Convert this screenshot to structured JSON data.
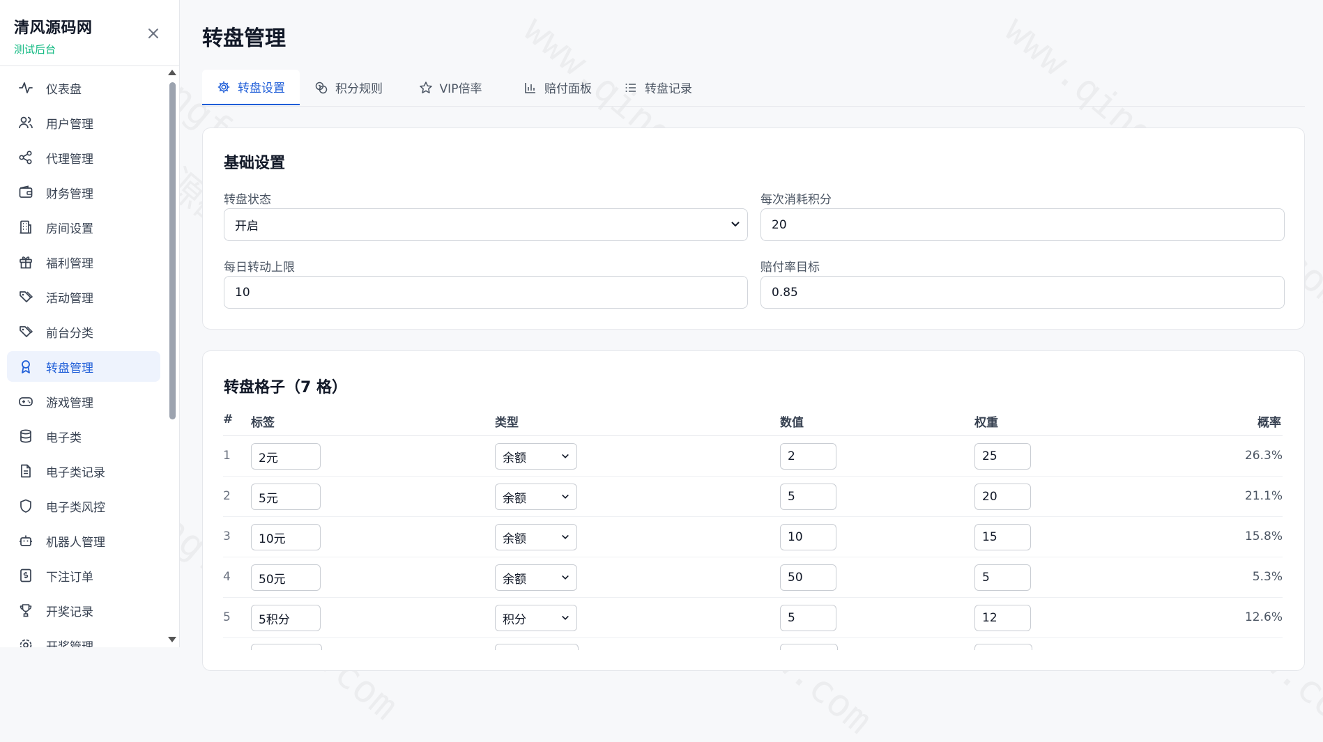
{
  "brand": {
    "title": "清风源码网",
    "subtitle": "测试后台"
  },
  "sidebar": {
    "items": [
      {
        "label": "仪表盘",
        "icon": "activity-icon"
      },
      {
        "label": "用户管理",
        "icon": "users-icon"
      },
      {
        "label": "代理管理",
        "icon": "share-icon"
      },
      {
        "label": "财务管理",
        "icon": "wallet-icon"
      },
      {
        "label": "房间设置",
        "icon": "building-icon"
      },
      {
        "label": "福利管理",
        "icon": "gift-icon"
      },
      {
        "label": "活动管理",
        "icon": "tags-icon"
      },
      {
        "label": "前台分类",
        "icon": "tags-icon"
      },
      {
        "label": "转盘管理",
        "icon": "award-icon",
        "active": true
      },
      {
        "label": "游戏管理",
        "icon": "gamepad-icon"
      },
      {
        "label": "电子类",
        "icon": "database-icon"
      },
      {
        "label": "电子类记录",
        "icon": "file-text-icon"
      },
      {
        "label": "电子类风控",
        "icon": "shield-icon"
      },
      {
        "label": "机器人管理",
        "icon": "bot-icon"
      },
      {
        "label": "下注订单",
        "icon": "receipt-icon"
      },
      {
        "label": "开奖记录",
        "icon": "trophy-icon"
      },
      {
        "label": "开奖管理",
        "icon": "settings-icon"
      }
    ]
  },
  "page": {
    "title": "转盘管理"
  },
  "tabs": [
    {
      "label": "转盘设置",
      "icon": "gear-icon",
      "active": true
    },
    {
      "label": "积分规则",
      "icon": "coins-icon"
    },
    {
      "label": "VIP倍率",
      "icon": "star-icon"
    },
    {
      "label": "赔付面板",
      "icon": "bar-chart-icon"
    },
    {
      "label": "转盘记录",
      "icon": "list-icon"
    }
  ],
  "basic": {
    "title": "基础设置",
    "status_label": "转盘状态",
    "status_value": "开启",
    "cost_label": "每次消耗积分",
    "cost_value": "20",
    "daily_label": "每日转动上限",
    "daily_value": "10",
    "payout_label": "赔付率目标",
    "payout_value": "0.85"
  },
  "slots": {
    "title": "转盘格子（7 格）",
    "headers": {
      "idx": "#",
      "label": "标签",
      "type": "类型",
      "value": "数值",
      "weight": "权重",
      "prob": "概率"
    },
    "rows": [
      {
        "idx": "1",
        "label": "2元",
        "type": "余额",
        "value": "2",
        "weight": "25",
        "prob": "26.3%"
      },
      {
        "idx": "2",
        "label": "5元",
        "type": "余额",
        "value": "5",
        "weight": "20",
        "prob": "21.1%"
      },
      {
        "idx": "3",
        "label": "10元",
        "type": "余额",
        "value": "10",
        "weight": "15",
        "prob": "15.8%"
      },
      {
        "idx": "4",
        "label": "50元",
        "type": "余额",
        "value": "50",
        "weight": "5",
        "prob": "5.3%"
      },
      {
        "idx": "5",
        "label": "5积分",
        "type": "积分",
        "value": "5",
        "weight": "12",
        "prob": "12.6%"
      }
    ]
  },
  "watermark": {
    "url": "www.qingfengymw.com",
    "name": "清风源码"
  },
  "colors": {
    "accent": "#1f5ed8",
    "brand_green": "#10b981",
    "active_bg": "#eef3fd"
  }
}
